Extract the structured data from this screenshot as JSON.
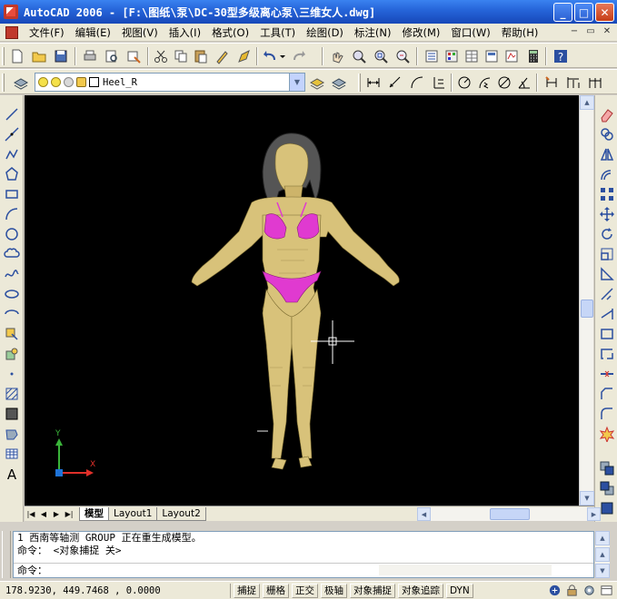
{
  "window": {
    "title": "AutoCAD 2006 - [F:\\图纸\\泵\\DC-30型多级离心泵\\三维女人.dwg]",
    "minimize": "_",
    "maximize": "□",
    "close": "✕"
  },
  "menu": {
    "items": [
      "文件(F)",
      "编辑(E)",
      "视图(V)",
      "插入(I)",
      "格式(O)",
      "工具(T)",
      "绘图(D)",
      "标注(N)",
      "修改(M)",
      "窗口(W)",
      "帮助(H)"
    ],
    "mdi_min": "−",
    "mdi_restore": "▭",
    "mdi_close": "✕"
  },
  "layer": {
    "current": "Heel_R",
    "on_color": "#f5e14a",
    "color_square": "#ffffff"
  },
  "layout_tabs": [
    "模型",
    "Layout1",
    "Layout2"
  ],
  "tab_nav": [
    "|◀",
    "◀",
    "▶",
    "▶|"
  ],
  "ucs": {
    "x_label": "X",
    "y_label": "Y",
    "x_color": "#e0302a",
    "y_color": "#3ab43a"
  },
  "command": {
    "history": [
      "1 西南等轴测 GROUP 正在重生成模型。",
      "命令：  <对象捕捉 关>"
    ],
    "prompt": "命令："
  },
  "status": {
    "coords": "178.9230,  449.7468 , 0.0000",
    "toggles": [
      "捕捉",
      "栅格",
      "正交",
      "极轴",
      "对象捕捉",
      "对象追踪",
      "DYN"
    ]
  },
  "colors": {
    "canvas": "#000000",
    "model_gold": "#d8c27a",
    "bikini": "#e03ad0",
    "hair": "#555555"
  }
}
